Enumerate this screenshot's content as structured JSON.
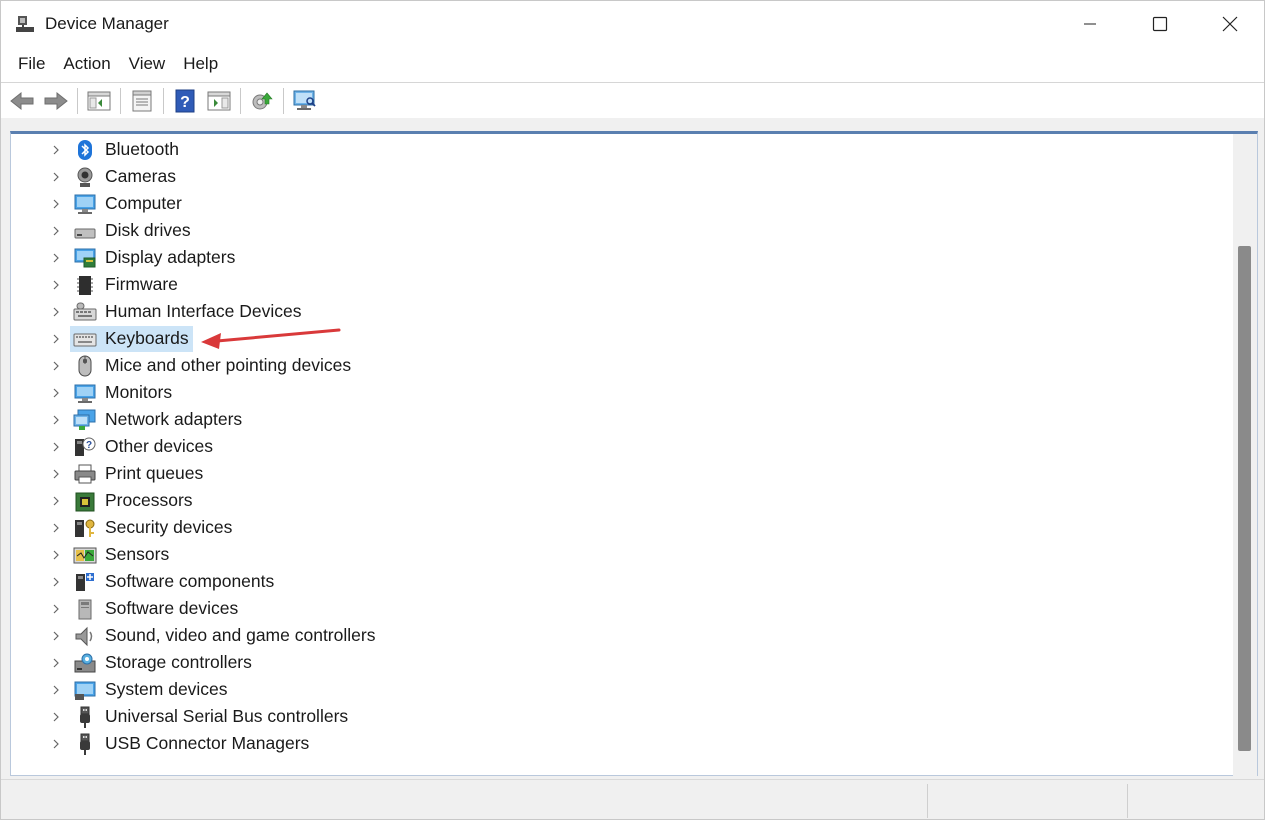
{
  "window": {
    "title": "Device Manager"
  },
  "menu": [
    "File",
    "Action",
    "View",
    "Help"
  ],
  "toolbar_icons": [
    "back-icon",
    "forward-icon",
    "show-hide-tree-icon",
    "properties-icon",
    "help-icon",
    "action-pane-icon",
    "update-driver-icon",
    "scan-hardware-icon"
  ],
  "tree": {
    "items": [
      {
        "label": "Bluetooth",
        "icon": "bluetooth-icon"
      },
      {
        "label": "Cameras",
        "icon": "camera-icon"
      },
      {
        "label": "Computer",
        "icon": "computer-icon"
      },
      {
        "label": "Disk drives",
        "icon": "disk-drive-icon"
      },
      {
        "label": "Display adapters",
        "icon": "display-adapter-icon"
      },
      {
        "label": "Firmware",
        "icon": "firmware-icon"
      },
      {
        "label": "Human Interface Devices",
        "icon": "hid-icon"
      },
      {
        "label": "Keyboards",
        "icon": "keyboard-icon",
        "selected": true
      },
      {
        "label": "Mice and other pointing devices",
        "icon": "mouse-icon"
      },
      {
        "label": "Monitors",
        "icon": "monitor-icon"
      },
      {
        "label": "Network adapters",
        "icon": "network-adapter-icon"
      },
      {
        "label": "Other devices",
        "icon": "other-devices-icon"
      },
      {
        "label": "Print queues",
        "icon": "printer-icon"
      },
      {
        "label": "Processors",
        "icon": "processor-icon"
      },
      {
        "label": "Security devices",
        "icon": "security-device-icon"
      },
      {
        "label": "Sensors",
        "icon": "sensor-icon"
      },
      {
        "label": "Software components",
        "icon": "software-component-icon"
      },
      {
        "label": "Software devices",
        "icon": "software-device-icon"
      },
      {
        "label": "Sound, video and game controllers",
        "icon": "sound-icon"
      },
      {
        "label": "Storage controllers",
        "icon": "storage-controller-icon"
      },
      {
        "label": "System devices",
        "icon": "system-devices-icon"
      },
      {
        "label": "Universal Serial Bus controllers",
        "icon": "usb-icon"
      },
      {
        "label": "USB Connector Managers",
        "icon": "usb-connector-icon"
      }
    ]
  },
  "colors": {
    "selection": "#cce4f7",
    "arrow": "#d9393a",
    "scroll_thumb": "#8a8a8a"
  }
}
